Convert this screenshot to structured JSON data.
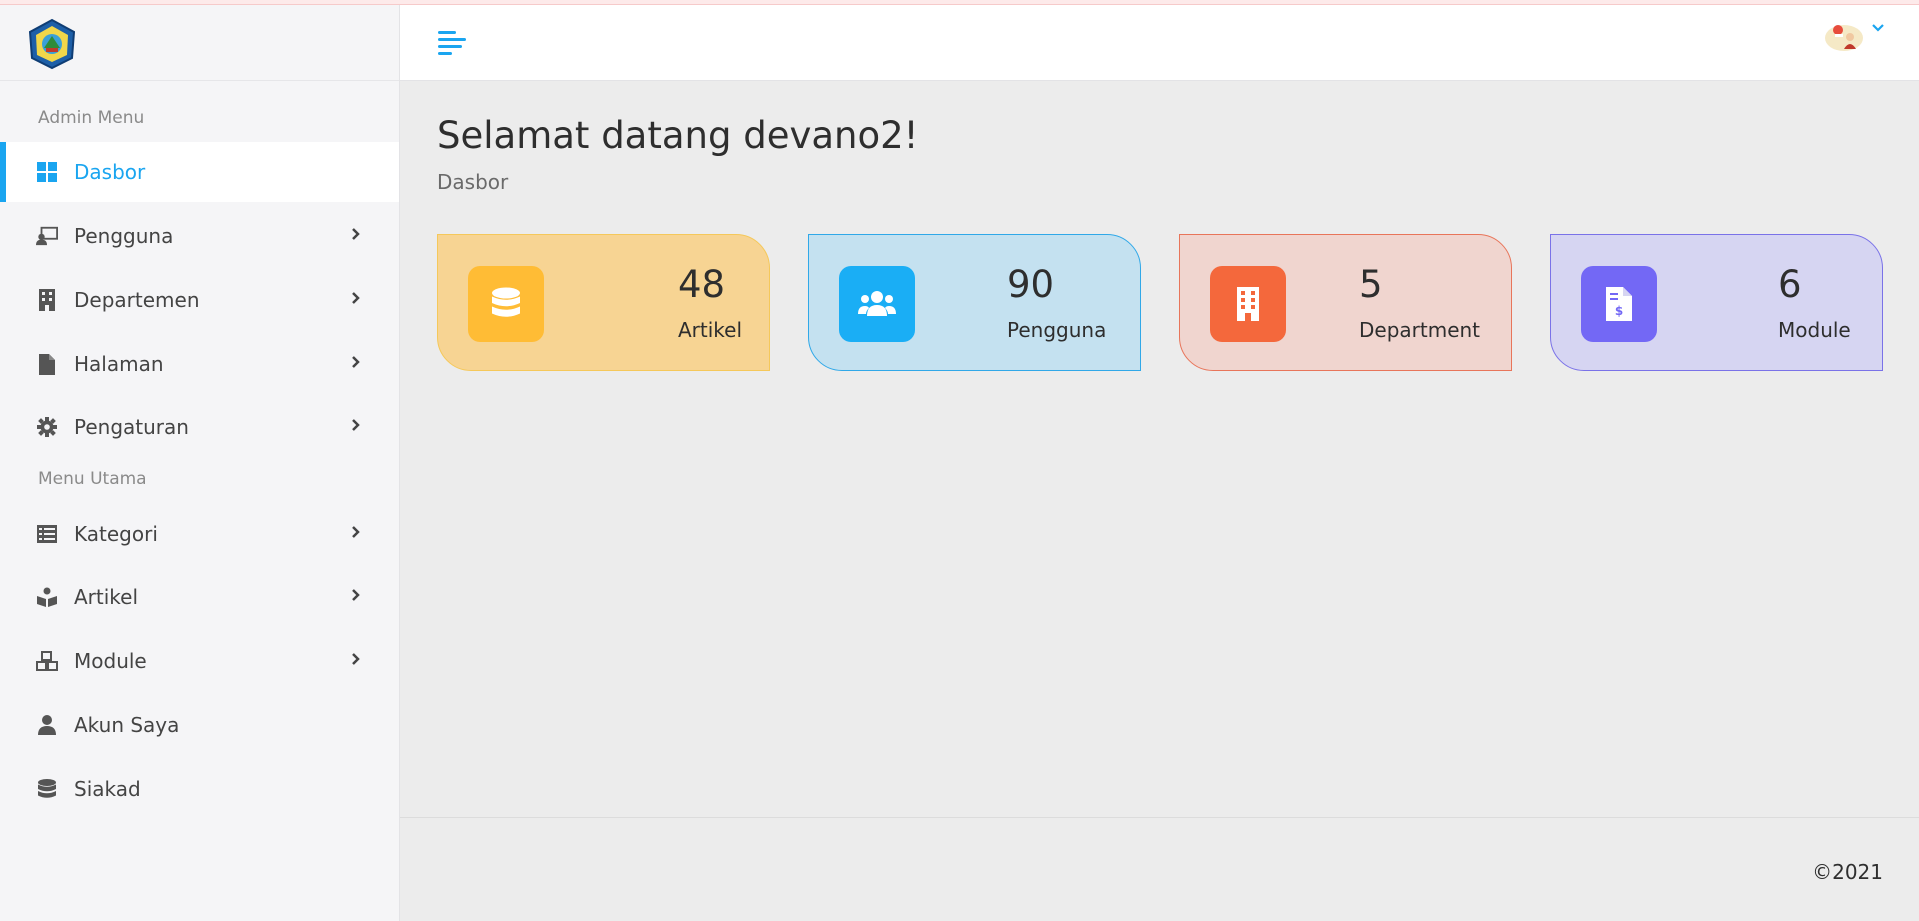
{
  "sidebar": {
    "sections": {
      "admin": "Admin Menu",
      "main": "Menu Utama"
    },
    "items": [
      {
        "label": "Dasbor",
        "icon": "dashboard-grid-icon",
        "active": true,
        "has_children": false
      },
      {
        "label": "Pengguna",
        "icon": "user-board-icon",
        "active": false,
        "has_children": true
      },
      {
        "label": "Departemen",
        "icon": "building-icon",
        "active": false,
        "has_children": true
      },
      {
        "label": "Halaman",
        "icon": "file-icon",
        "active": false,
        "has_children": true
      },
      {
        "label": "Pengaturan",
        "icon": "gear-icon",
        "active": false,
        "has_children": true
      },
      {
        "label": "Kategori",
        "icon": "list-icon",
        "active": false,
        "has_children": true
      },
      {
        "label": "Artikel",
        "icon": "book-reader-icon",
        "active": false,
        "has_children": true
      },
      {
        "label": "Module",
        "icon": "cubes-icon",
        "active": false,
        "has_children": true
      },
      {
        "label": "Akun Saya",
        "icon": "user-icon",
        "active": false,
        "has_children": false
      },
      {
        "label": "Siakad",
        "icon": "database-icon",
        "active": false,
        "has_children": false
      }
    ]
  },
  "header": {
    "menu_icon": "hamburger-icon",
    "avatar_icon": "user-avatar-icon"
  },
  "main": {
    "title": "Selamat datang devano2!",
    "breadcrumb": "Dasbor",
    "cards": [
      {
        "value": "48",
        "label": "Artikel",
        "icon": "database-icon",
        "accent": "#ffbc35",
        "bg": "#f7d493",
        "border": "#f5c85a"
      },
      {
        "value": "90",
        "label": "Pengguna",
        "icon": "users-icon",
        "accent": "#1aaef5",
        "bg": "#c4e1f0",
        "border": "#30a8e8"
      },
      {
        "value": "5",
        "label": "Department",
        "icon": "building-icon",
        "accent": "#f4683c",
        "bg": "#f0d5cf",
        "border": "#e8755a"
      },
      {
        "value": "6",
        "label": "Module",
        "icon": "invoice-icon",
        "accent": "#7368f5",
        "bg": "#d6d5f2",
        "border": "#7a72e8"
      }
    ]
  },
  "footer": {
    "copyright": "©2021"
  },
  "colors": {
    "primary": "#1aa5f0",
    "sidebar_bg": "#f5f5f7",
    "content_bg": "#ececec"
  }
}
